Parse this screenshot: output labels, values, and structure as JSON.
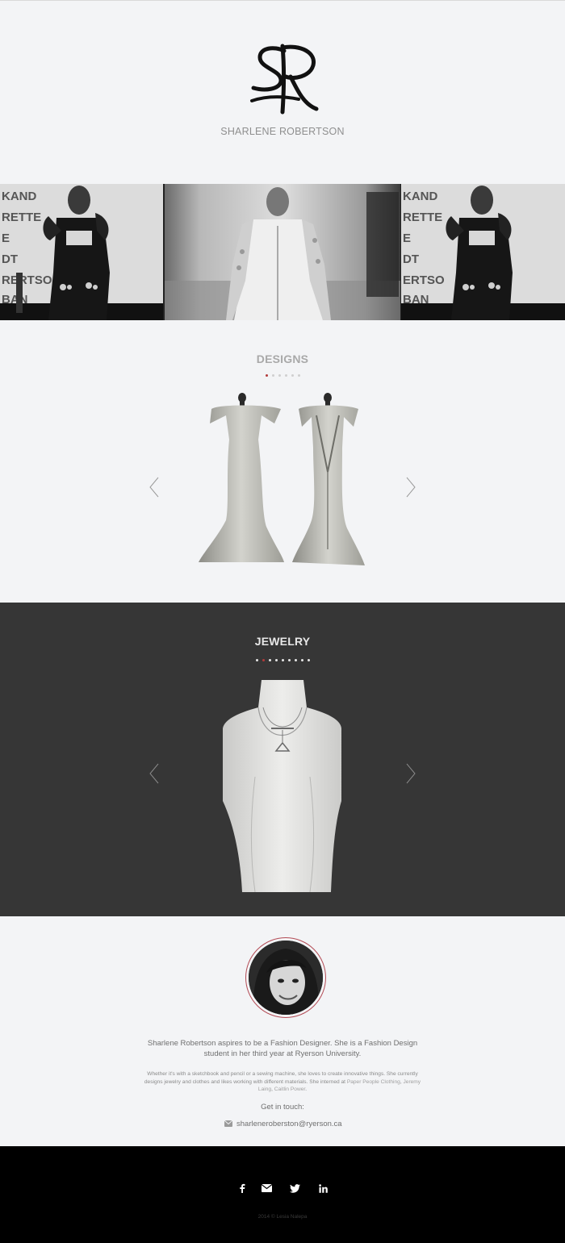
{
  "header": {
    "brand_name": "SHARLENE ROBERTSON",
    "logo_letters": "SR"
  },
  "hero": {
    "panels": [
      {
        "backdrop_text": [
          "KAND",
          "RETTE",
          "E",
          "DT",
          "RERTSO",
          "BAN"
        ]
      },
      {
        "backdrop_text": []
      },
      {
        "backdrop_text": [
          "KAND",
          "RETTE",
          "E",
          "DT",
          "ERTSO",
          "BAN"
        ]
      }
    ]
  },
  "designs": {
    "title": "DESIGNS",
    "slide_count": 6,
    "active_slide": 1,
    "prev_icon": "chevron-left-icon",
    "next_icon": "chevron-right-icon"
  },
  "jewelry": {
    "title": "JEWELRY",
    "slide_count": 9,
    "active_slide": 2,
    "prev_icon": "chevron-left-icon",
    "next_icon": "chevron-right-icon"
  },
  "about": {
    "lead": "Sharlene Robertson aspires to be a Fashion Designer. She is a Fashion Design student in her third year at Ryerson University.",
    "body_intro": "Whether it's with a sketchbook and pencil or a sewing machine, she loves to create innovative things. She currently designs jewelry and clothes and likes working with different materials. She interned at ",
    "internships": [
      "Paper People Clothing",
      "Jeremy Laing",
      "Caitlin Power"
    ],
    "internship_sep_1": ", ",
    "internship_sep_2": ", ",
    "body_end": ".",
    "get_in_touch": "Get in touch:",
    "email": "sharleneroberston@ryerson.ca"
  },
  "footer": {
    "social": [
      {
        "name": "facebook-icon"
      },
      {
        "name": "mail-icon"
      },
      {
        "name": "twitter-icon"
      },
      {
        "name": "linkedin-icon"
      }
    ],
    "copyright": "2014 © Lesia Nalepa"
  },
  "colors": {
    "accent": "#b23a3a",
    "page_bg": "#f3f4f6",
    "dark_section": "#363636",
    "footer": "#000000"
  }
}
